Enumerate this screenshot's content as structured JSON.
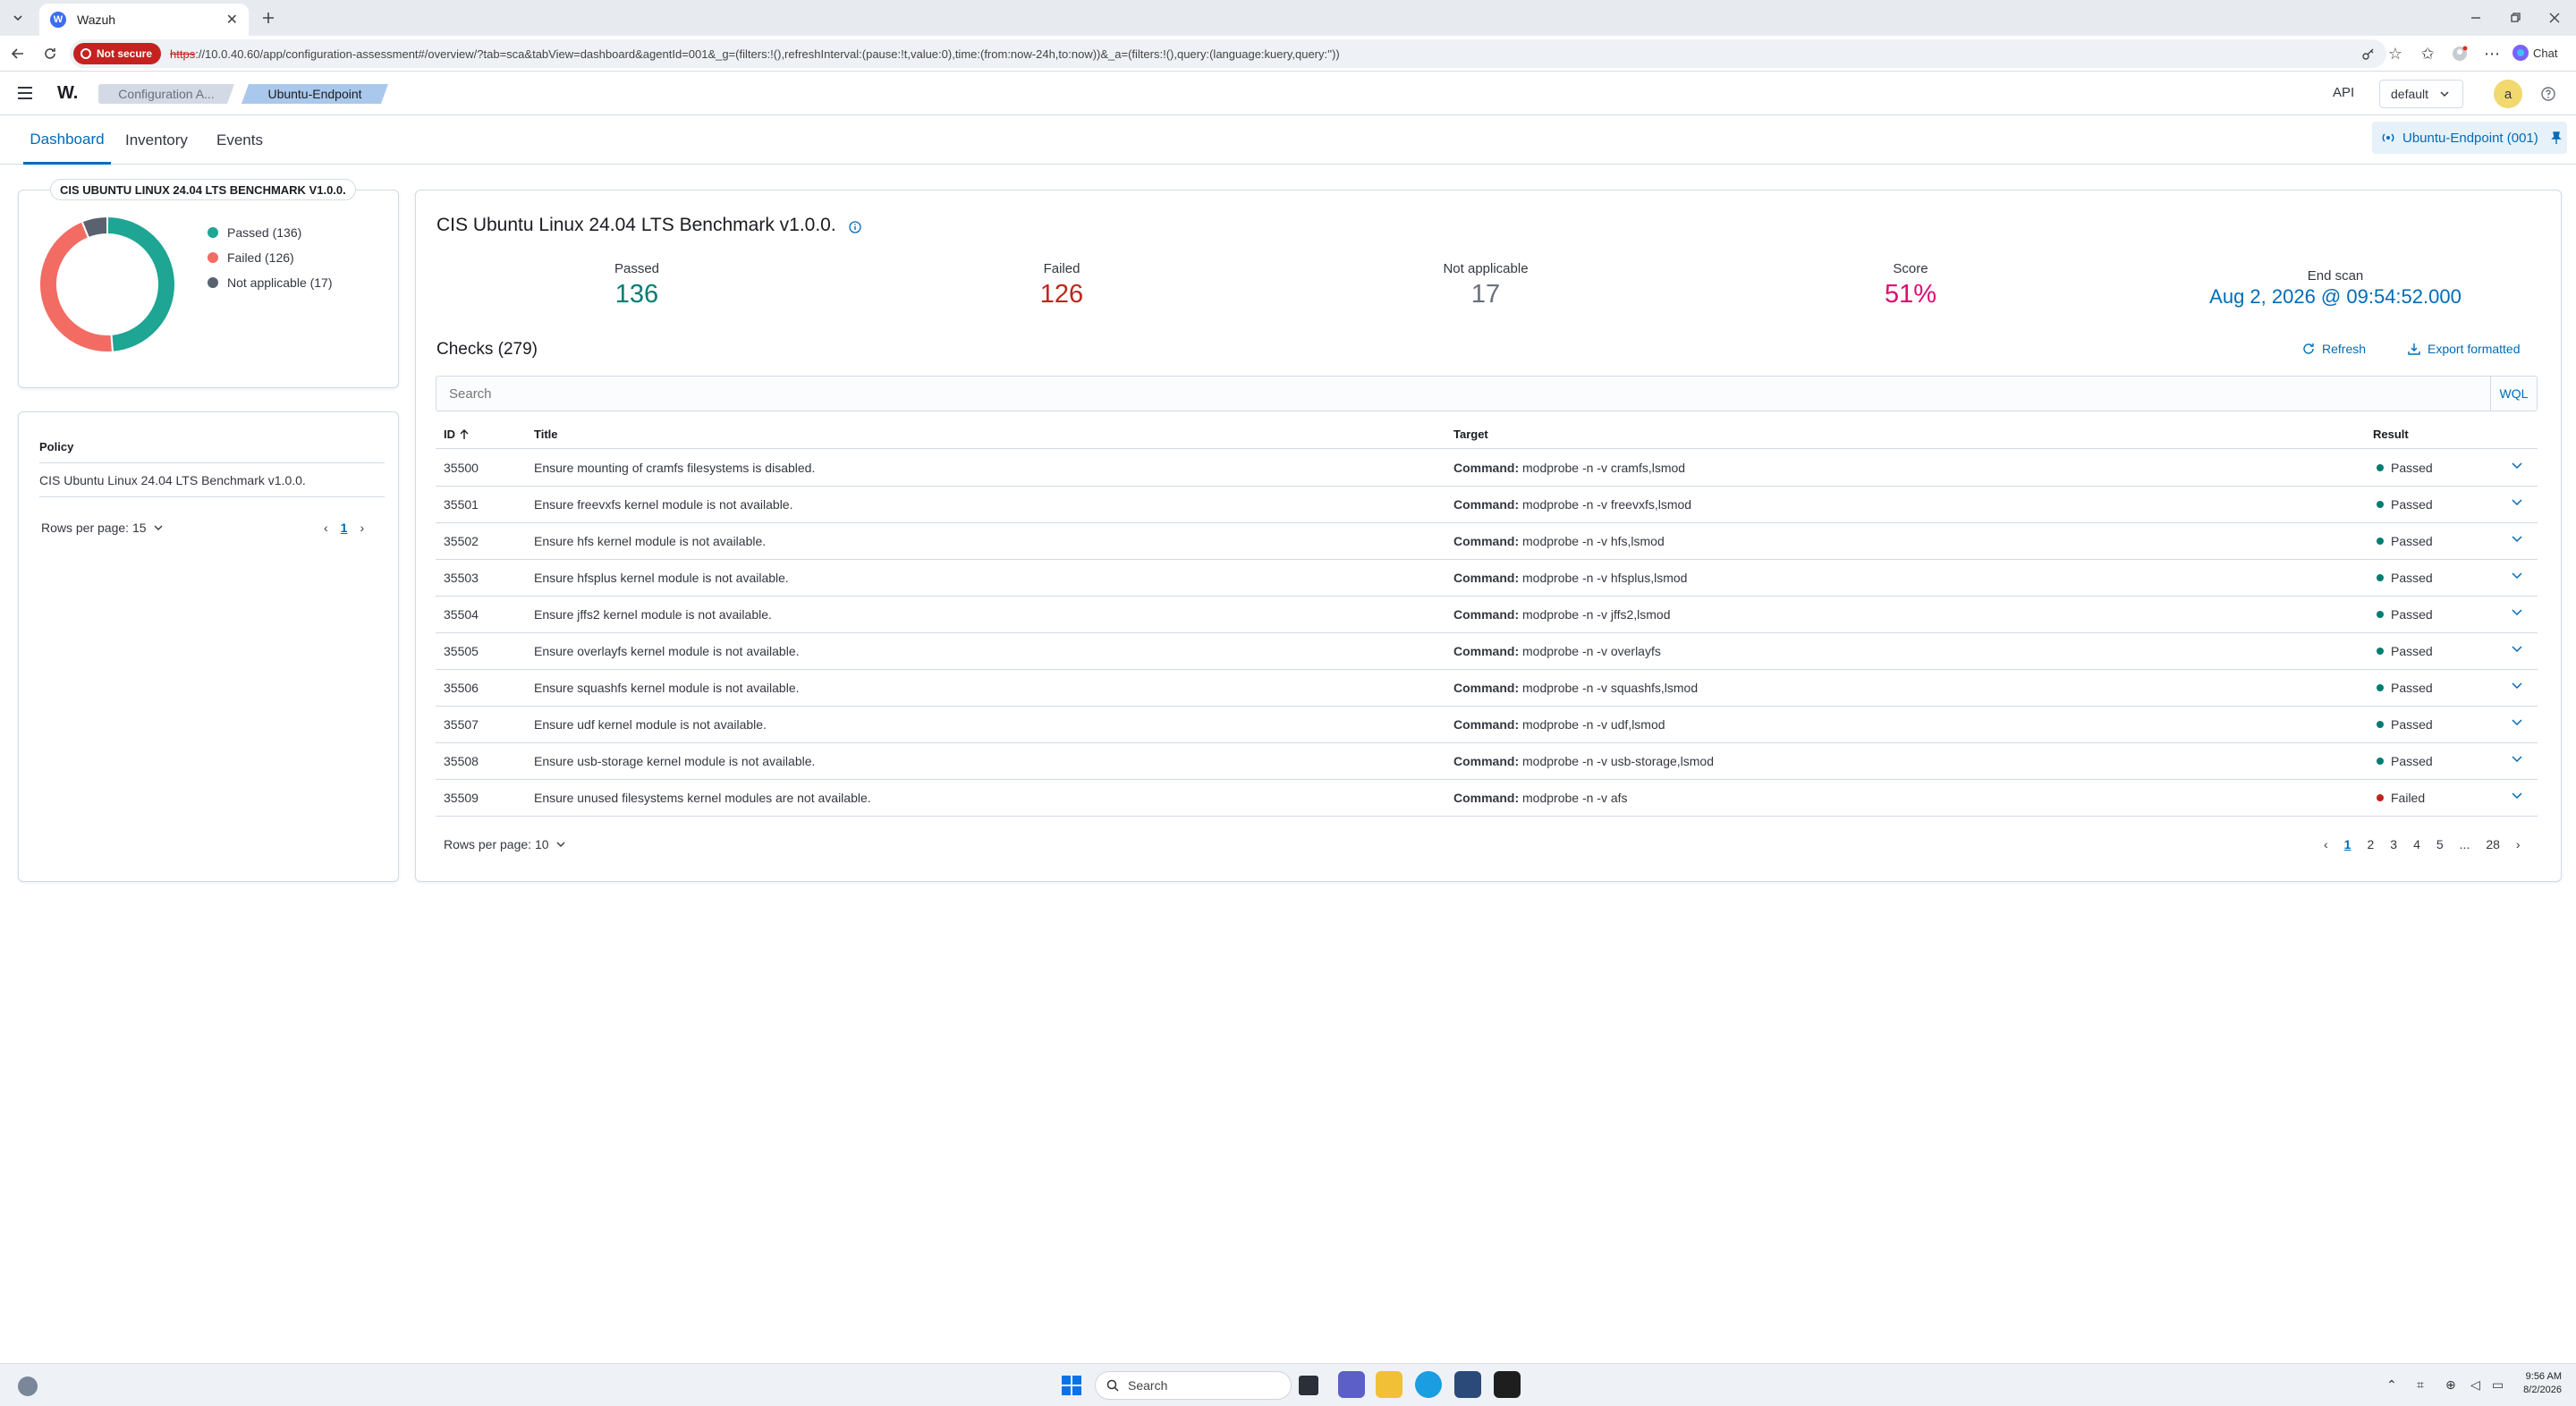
{
  "browser": {
    "tab_title": "Wazuh",
    "favicon_letter": "W",
    "not_secure": "Not secure",
    "url_scheme": "https",
    "url_rest": "://10.0.40.60/app/configuration-assessment#/overview/?tab=sca&tabView=dashboard&agentId=001&_g=(filters:!(),refreshInterval:(pause:!t,value:0),time:(from:now-24h,to:now))&_a=(filters:!(),query:(language:kuery,query:''))",
    "chat_label": "Chat"
  },
  "header": {
    "logo": "W.",
    "breadcrumb_1": "Configuration A...",
    "breadcrumb_2": "Ubuntu-Endpoint",
    "api_label": "API",
    "default_select": "default",
    "avatar_letter": "a"
  },
  "tabs": [
    {
      "label": "Dashboard",
      "active": true
    },
    {
      "label": "Inventory",
      "active": false
    },
    {
      "label": "Events",
      "active": false
    }
  ],
  "agent_pill": "Ubuntu-Endpoint (001)",
  "chart_panel": {
    "title": "CIS UBUNTU LINUX 24.04 LTS BENCHMARK V1.0.0.",
    "legend": [
      {
        "label": "Passed (136)",
        "color": "#1ea593"
      },
      {
        "label": "Failed (126)",
        "color": "#f26c64"
      },
      {
        "label": "Not applicable (17)",
        "color": "#5a6270"
      }
    ]
  },
  "chart_data": {
    "type": "pie",
    "categories": [
      "Passed",
      "Failed",
      "Not applicable"
    ],
    "values": [
      136,
      126,
      17
    ],
    "colors": [
      "#1ea593",
      "#f26c64",
      "#5a6270"
    ],
    "donut": true,
    "title": "CIS UBUNTU LINUX 24.04 LTS BENCHMARK V1.0.0."
  },
  "policy_panel": {
    "header": "Policy",
    "policy_name": "CIS Ubuntu Linux 24.04 LTS Benchmark v1.0.0.",
    "rows_per_page": "Rows per page: 15",
    "current_page": "1"
  },
  "main": {
    "title": "CIS Ubuntu Linux 24.04 LTS Benchmark v1.0.0.",
    "stats": [
      {
        "label": "Passed",
        "value": "136",
        "color": "#017d73"
      },
      {
        "label": "Failed",
        "value": "126",
        "color": "#bd271e"
      },
      {
        "label": "Not applicable",
        "value": "17",
        "color": "#69707d"
      },
      {
        "label": "Score",
        "value": "51%",
        "color": "#dd0a73"
      },
      {
        "label": "End scan",
        "value": "Aug 2, 2026 @ 09:54:52.000",
        "color": "#006bb8"
      }
    ],
    "checks_title": "Checks (279)",
    "refresh": "Refresh",
    "export": "Export formatted",
    "search_placeholder": "Search",
    "wql": "WQL",
    "columns": {
      "id": "ID",
      "title": "Title",
      "target": "Target",
      "result": "Result"
    },
    "command_label": "Command:",
    "rows": [
      {
        "id": "35500",
        "title": "Ensure mounting of cramfs filesystems is disabled.",
        "cmd": "modprobe -n -v cramfs,lsmod",
        "result": "Passed"
      },
      {
        "id": "35501",
        "title": "Ensure freevxfs kernel module is not available.",
        "cmd": "modprobe -n -v freevxfs,lsmod",
        "result": "Passed"
      },
      {
        "id": "35502",
        "title": "Ensure hfs kernel module is not available.",
        "cmd": "modprobe -n -v hfs,lsmod",
        "result": "Passed"
      },
      {
        "id": "35503",
        "title": "Ensure hfsplus kernel module is not available.",
        "cmd": "modprobe -n -v hfsplus,lsmod",
        "result": "Passed"
      },
      {
        "id": "35504",
        "title": "Ensure jffs2 kernel module is not available.",
        "cmd": "modprobe -n -v jffs2,lsmod",
        "result": "Passed"
      },
      {
        "id": "35505",
        "title": "Ensure overlayfs kernel module is not available.",
        "cmd": "modprobe -n -v overlayfs",
        "result": "Passed"
      },
      {
        "id": "35506",
        "title": "Ensure squashfs kernel module is not available.",
        "cmd": "modprobe -n -v squashfs,lsmod",
        "result": "Passed"
      },
      {
        "id": "35507",
        "title": "Ensure udf kernel module is not available.",
        "cmd": "modprobe -n -v udf,lsmod",
        "result": "Passed"
      },
      {
        "id": "35508",
        "title": "Ensure usb-storage kernel module is not available.",
        "cmd": "modprobe -n -v usb-storage,lsmod",
        "result": "Passed"
      },
      {
        "id": "35509",
        "title": "Ensure unused filesystems kernel modules are not available.",
        "cmd": "modprobe -n -v afs",
        "result": "Failed"
      }
    ],
    "status_colors": {
      "Passed": "#017d73",
      "Failed": "#bd271e"
    },
    "rows_per_page": "Rows per page: 10",
    "pages": [
      "1",
      "2",
      "3",
      "4",
      "5",
      "...",
      "28"
    ]
  },
  "taskbar": {
    "search": "Search",
    "time": "9:56 AM",
    "date": "8/2/2026"
  }
}
